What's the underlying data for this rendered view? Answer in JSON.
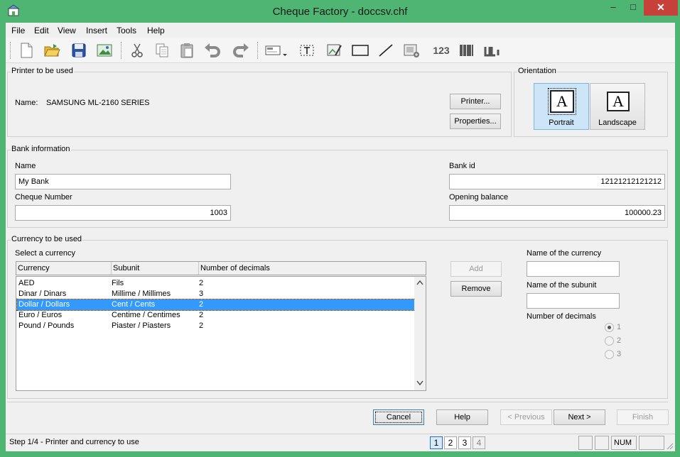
{
  "window": {
    "title": "Cheque Factory - doccsv.chf",
    "min_glyph": "–",
    "max_glyph": "□",
    "close_glyph": "✕"
  },
  "menu": [
    "File",
    "Edit",
    "View",
    "Insert",
    "Tools",
    "Help"
  ],
  "toolbar": {
    "numbers_label": "123"
  },
  "printer": {
    "legend": "Printer to be used",
    "name_label": "Name:",
    "name_value": "SAMSUNG ML-2160 SERIES",
    "printer_button": "Printer...",
    "properties_button": "Properties..."
  },
  "orientation": {
    "legend": "Orientation",
    "glyph": "A",
    "portrait": "Portrait",
    "landscape": "Landscape",
    "selected": "Portrait"
  },
  "bank": {
    "legend": "Bank information",
    "name_label": "Name",
    "name_value": "My Bank",
    "bank_id_label": "Bank id",
    "bank_id_value": "12121212121212",
    "cheque_number_label": "Cheque Number",
    "cheque_number_value": "1003",
    "opening_balance_label": "Opening balance",
    "opening_balance_value": "100000.23"
  },
  "currency": {
    "legend": "Currency to be used",
    "select_label": "Select a currency",
    "columns": [
      "Currency",
      "Subunit",
      "Number of decimals"
    ],
    "rows": [
      [
        "AED",
        "Fils",
        "2"
      ],
      [
        "Dinar / Dinars",
        "Millime / Millimes",
        "3"
      ],
      [
        "Dollar / Dollars",
        "Cent / Cents",
        "2"
      ],
      [
        "Euro / Euros",
        "Centime / Centimes",
        "2"
      ],
      [
        "Pound / Pounds",
        "Piaster / Piasters",
        "2"
      ]
    ],
    "selected_row": 2,
    "add_button": "Add",
    "remove_button": "Remove",
    "name_currency_label": "Name of the currency",
    "name_currency_value": "",
    "name_subunit_label": "Name of the subunit",
    "name_subunit_value": "",
    "decimals_label": "Number of decimals",
    "decimals_options": [
      "1",
      "2",
      "3"
    ],
    "decimals_selected": "1"
  },
  "nav": {
    "cancel": "Cancel",
    "help": "Help",
    "previous": "< Previous",
    "next": "Next >",
    "finish": "Finish"
  },
  "status": {
    "text": "Step 1/4 - Printer and currency to use",
    "steps": [
      "1",
      "2",
      "3",
      "4"
    ],
    "current_step": "1",
    "num": "NUM"
  }
}
